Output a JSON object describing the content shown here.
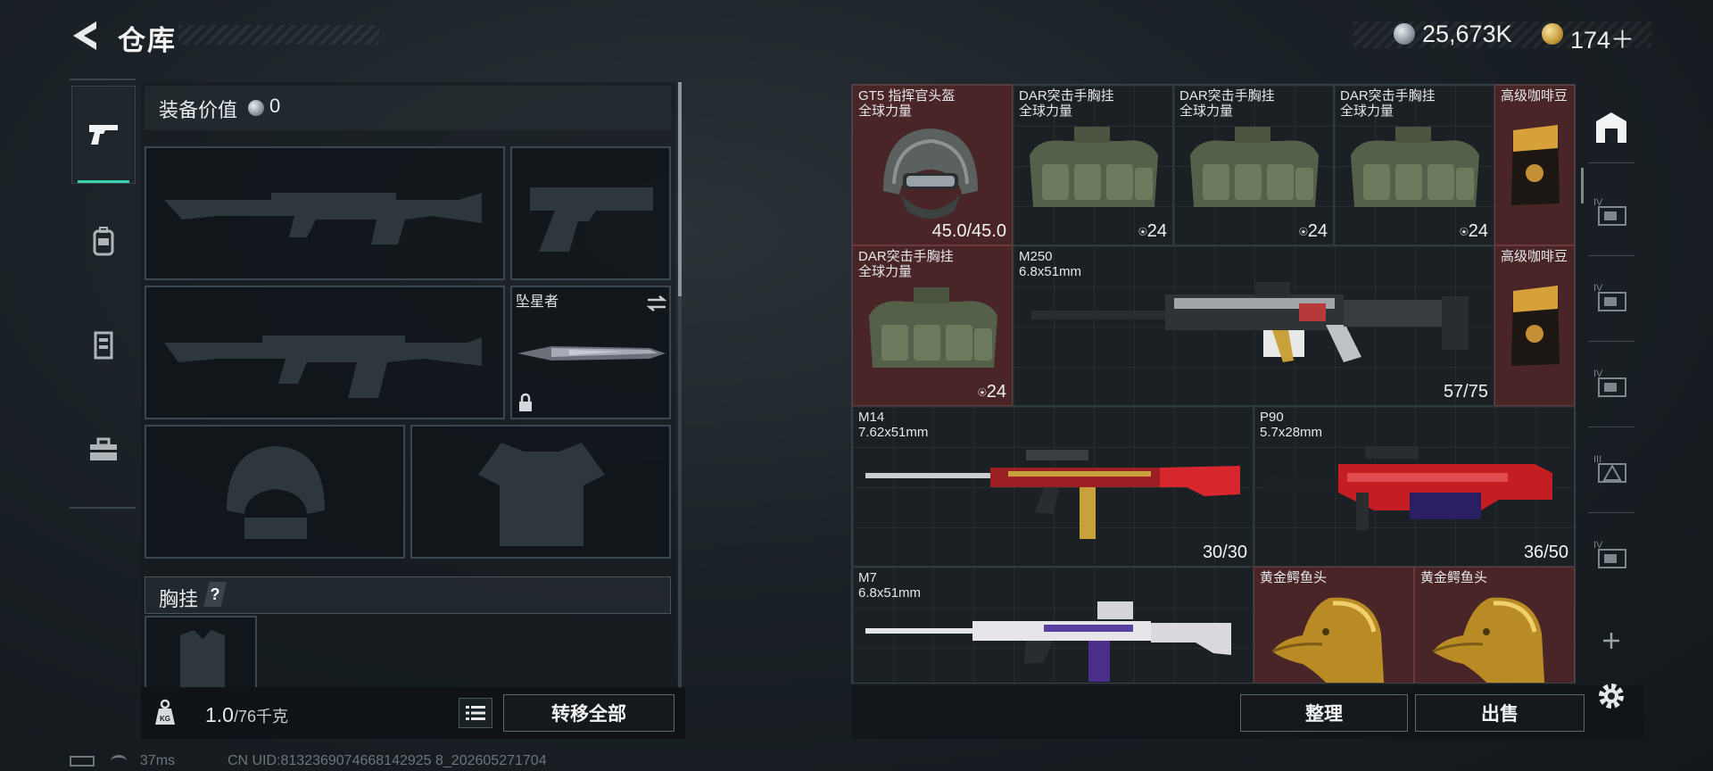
{
  "header": {
    "title": "仓库",
    "money": "25,673K",
    "gold": "174＋"
  },
  "nav": {
    "items": [
      {
        "icon": "pistol-icon",
        "active": true
      },
      {
        "icon": "backpack-icon",
        "active": false
      },
      {
        "icon": "armor-vest-icon",
        "active": false
      },
      {
        "icon": "toolbox-icon",
        "active": false
      }
    ]
  },
  "loadout": {
    "equip_value_label": "装备价值",
    "equip_value": "0",
    "knife_label": "坠星者",
    "chest_rig_label": "胸挂",
    "chest_rig_help": "?",
    "weight_value": "1.0",
    "weight_capacity": "/76千克",
    "transfer_all": "转移全部"
  },
  "stash": {
    "items": [
      {
        "name": "GT5 指挥官头盔",
        "sub": "全球力量",
        "count": "45.0/45.0",
        "type": "helmet",
        "rarity": "red"
      },
      {
        "name": "DAR突击手胸挂",
        "sub": "全球力量",
        "count": "24",
        "type": "rig",
        "rarity": "dark"
      },
      {
        "name": "DAR突击手胸挂",
        "sub": "全球力量",
        "count": "24",
        "type": "rig",
        "rarity": "dark"
      },
      {
        "name": "DAR突击手胸挂",
        "sub": "全球力量",
        "count": "24",
        "type": "rig",
        "rarity": "dark"
      },
      {
        "name": "高级咖啡豆",
        "sub": "",
        "count": "",
        "type": "coffee",
        "rarity": "red"
      },
      {
        "name": "DAR突击手胸挂",
        "sub": "全球力量",
        "count": "24",
        "type": "rig",
        "rarity": "red"
      },
      {
        "name": "M250",
        "sub": "6.8x51mm",
        "count": "57/75",
        "type": "lmg",
        "rarity": "dark"
      },
      {
        "name": "高级咖啡豆",
        "sub": "",
        "count": "",
        "type": "coffee",
        "rarity": "red"
      },
      {
        "name": "M14",
        "sub": "7.62x51mm",
        "count": "30/30",
        "type": "rifle",
        "rarity": "dark"
      },
      {
        "name": "P90",
        "sub": "5.7x28mm",
        "count": "36/50",
        "type": "smg",
        "rarity": "dark"
      },
      {
        "name": "M7",
        "sub": "6.8x51mm",
        "count": "",
        "type": "m7",
        "rarity": "dark"
      },
      {
        "name": "黄金鳄鱼头",
        "sub": "",
        "count": "",
        "type": "croc",
        "rarity": "red"
      },
      {
        "name": "黄金鳄鱼头",
        "sub": "",
        "count": "",
        "type": "croc",
        "rarity": "red"
      }
    ],
    "sort_label": "整理",
    "sell_label": "出售"
  },
  "sidebar": {
    "items": [
      "stash-main-icon",
      "stash-tab-4-icon",
      "stash-tab-4-icon",
      "stash-tab-4-icon",
      "stash-tab-3-icon",
      "stash-tab-4-icon",
      "add-icon",
      "settings-icon"
    ],
    "tab_levels": [
      "IV",
      "IV",
      "IV",
      "III",
      "IV"
    ]
  },
  "status": {
    "ping": "37ms",
    "uid": "CN UID:8132369074668142925 8_202605271704"
  },
  "colors": {
    "accent": "#3bd2b0",
    "rarity_red": "#4a2528",
    "panel": "#14191c"
  }
}
